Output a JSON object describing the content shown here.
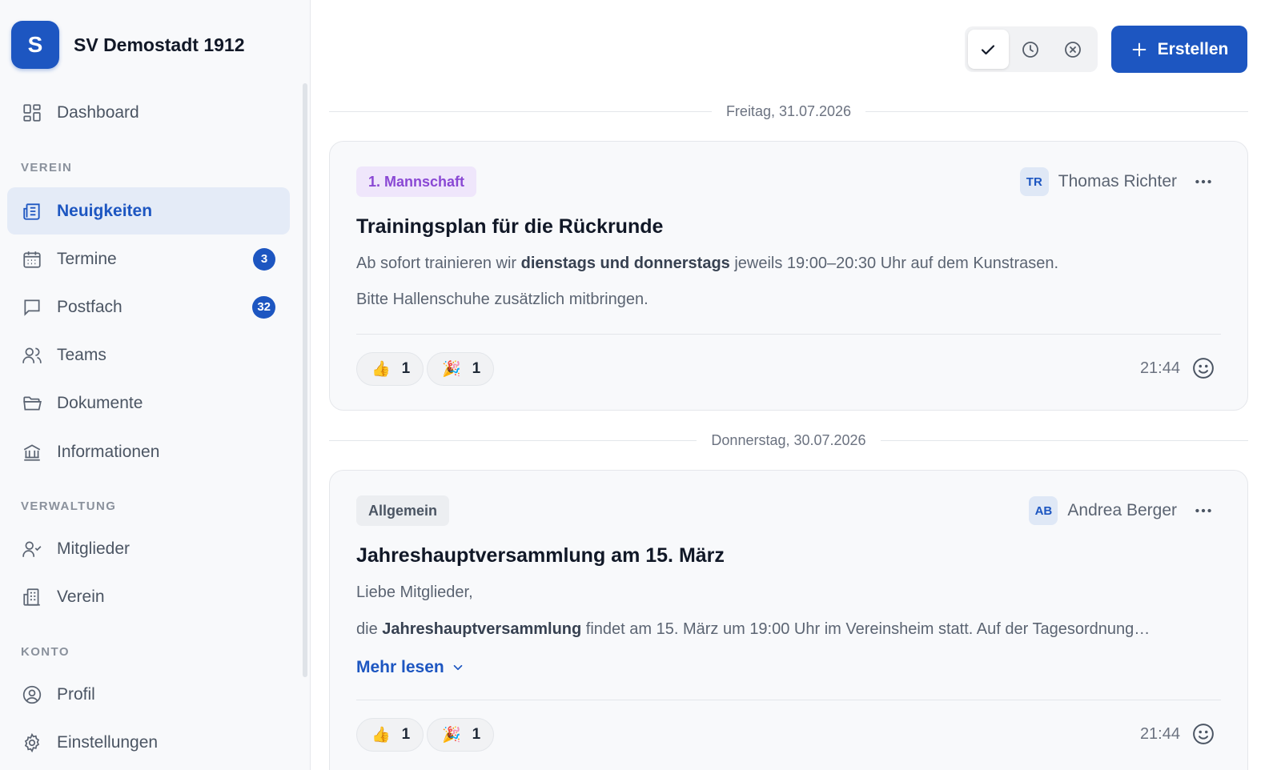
{
  "club": {
    "initial": "S",
    "name": "SV Demostadt 1912"
  },
  "nav": {
    "dashboard": "Dashboard",
    "sections": {
      "verein": "VEREIN",
      "verwaltung": "VERWALTUNG",
      "konto": "KONTO"
    },
    "neuigkeiten": "Neuigkeiten",
    "termine": "Termine",
    "termine_badge": "3",
    "postfach": "Postfach",
    "postfach_badge": "32",
    "teams": "Teams",
    "dokumente": "Dokumente",
    "informationen": "Informationen",
    "mitglieder": "Mitglieder",
    "verein": "Verein",
    "profil": "Profil",
    "einstellungen": "Einstellungen"
  },
  "toolbar": {
    "create_label": "Erstellen"
  },
  "posts": [
    {
      "date": "Freitag, 31.07.2026",
      "tag": "1. Mannschaft",
      "author_initials": "TR",
      "author_name": "Thomas Richter",
      "title": "Trainingsplan für die Rückrunde",
      "line1_pre": "Ab sofort trainieren wir ",
      "line1_bold": "dienstags und donnerstags",
      "line1_post": " jeweils 19:00–20:30 Uhr auf dem Kunstrasen.",
      "line2": "Bitte Hallenschuhe zusätzlich mitbringen.",
      "reactions": [
        {
          "emoji": "👍",
          "count": "1"
        },
        {
          "emoji": "🎉",
          "count": "1"
        }
      ],
      "time": "21:44"
    },
    {
      "date": "Donnerstag, 30.07.2026",
      "tag": "Allgemein",
      "author_initials": "AB",
      "author_name": "Andrea Berger",
      "title": "Jahreshauptversammlung am 15. März",
      "line1": "Liebe Mitglieder,",
      "line2_pre": "die ",
      "line2_bold": "Jahreshauptversammlung",
      "line2_post": " findet am 15. März um 19:00 Uhr im Vereinsheim statt. Auf der Tagesordnung…",
      "read_more": "Mehr lesen",
      "reactions": [
        {
          "emoji": "👍",
          "count": "1"
        },
        {
          "emoji": "🎉",
          "count": "1"
        }
      ],
      "time": "21:44"
    }
  ],
  "colors": {
    "accent": "#1d56c1",
    "tag_purple": "#8a48d4"
  }
}
